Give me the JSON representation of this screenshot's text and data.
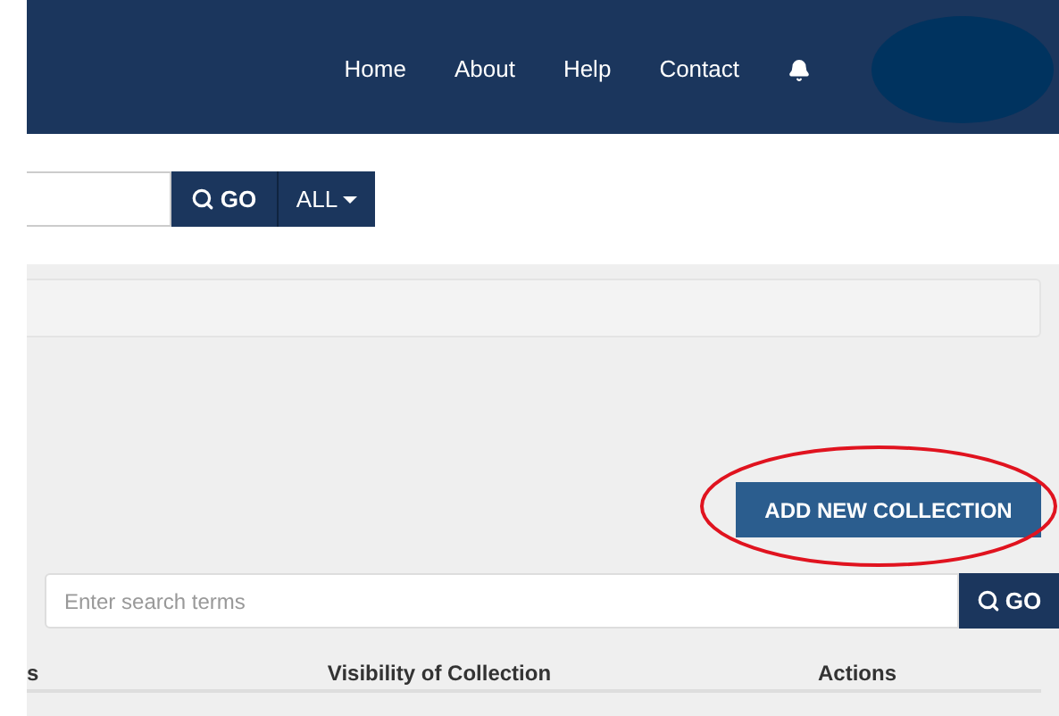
{
  "navbar": {
    "links": [
      {
        "label": "Home"
      },
      {
        "label": "About"
      },
      {
        "label": "Help"
      },
      {
        "label": "Contact"
      }
    ]
  },
  "top_search": {
    "go_label": "GO",
    "scope_label": "ALL"
  },
  "add_button": {
    "label": "ADD NEW COLLECTION"
  },
  "collection_search": {
    "placeholder": "Enter search terms",
    "go_label": "GO"
  },
  "table": {
    "columns": [
      {
        "label": "s"
      },
      {
        "label": "Visibility of Collection"
      },
      {
        "label": "Actions"
      }
    ]
  }
}
